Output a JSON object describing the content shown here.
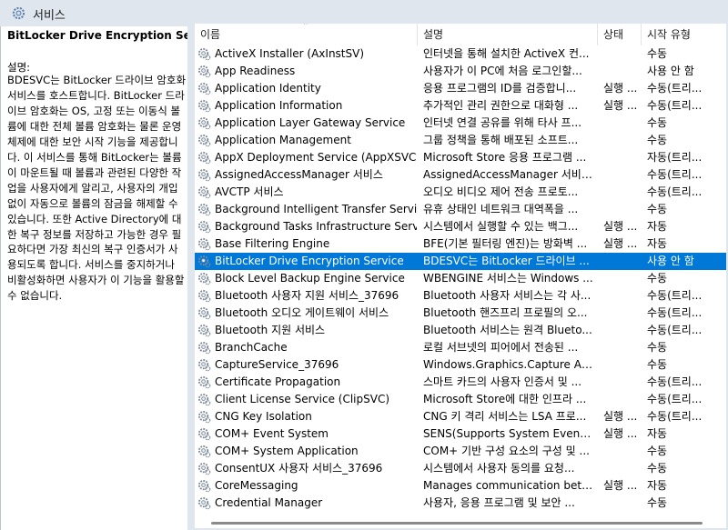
{
  "window": {
    "title": "서비스",
    "icon": "services-gear-icon"
  },
  "left_pane": {
    "service_title": "BitLocker Drive Encryption Service",
    "description_label": "설명:",
    "description_text": "BDESVC는 BitLocker 드라이브 암호화 서비스를 호스트합니다. BitLocker 드라이브 암호화는 OS, 고정 또는 이동식 볼륨에 대한 전체 볼륨 암호화는 물론 운영 체제에 대한 보안 시작 기능을 제공합니다. 이 서비스를 통해 BitLocker는 볼륨이 마운트될 때 볼륨과 관련된 다양한 작업을 사용자에게 알리고, 사용자의 개입 없이 자동으로 볼륨의 잠금을 해제할 수 있습니다. 또한 Active Directory에 대한 복구 정보를 저장하고 가능한 경우 필요하다면 가장 최신의 복구 인증서가 사용되도록 합니다. 서비스를 중지하거나 비활성화하면 사용자가 이 기능을 활용할 수 없습니다."
  },
  "columns": {
    "name": "이름",
    "description": "설명",
    "status": "상태",
    "startup": "시작 유형"
  },
  "selected_color": "#0078d7",
  "rows": [
    {
      "name": "ActiveX Installer (AxInstSV)",
      "desc": "인터넷을 통해 설치한 ActiveX 컨...",
      "status": "",
      "startup": "수동"
    },
    {
      "name": "App Readiness",
      "desc": "사용자가 이 PC에 처음 로그인할...",
      "status": "",
      "startup": "사용 안 함"
    },
    {
      "name": "Application Identity",
      "desc": "응용 프로그램의 ID를 검증합니...",
      "status": "실행 ...",
      "startup": "수동(트리..."
    },
    {
      "name": "Application Information",
      "desc": "추가적인 관리 권한으로 대화형 ...",
      "status": "실행 ...",
      "startup": "수동(트리..."
    },
    {
      "name": "Application Layer Gateway Service",
      "desc": "인터넷 연결 공유를 위해 타사 프...",
      "status": "",
      "startup": "수동"
    },
    {
      "name": "Application Management",
      "desc": "그룹 정책을 통해 배포된 소프트...",
      "status": "",
      "startup": "수동"
    },
    {
      "name": "AppX Deployment Service (AppXSVC)",
      "desc": "Microsoft Store 응용 프로그램 ...",
      "status": "",
      "startup": "자동(트리..."
    },
    {
      "name": "AssignedAccessManager 서비스",
      "desc": "AssignedAccessManager 서비스...",
      "status": "",
      "startup": "수동(트리..."
    },
    {
      "name": "AVCTP 서비스",
      "desc": "오디오 비디오 제어 전송 프로토...",
      "status": "",
      "startup": "수동(트리..."
    },
    {
      "name": "Background Intelligent Transfer Service",
      "desc": "유휴 상태인 네트워크 대역폭을 ...",
      "status": "",
      "startup": "수동"
    },
    {
      "name": "Background Tasks Infrastructure Service",
      "desc": "시스템에서 실행할 수 있는 백그...",
      "status": "실행 ...",
      "startup": "자동"
    },
    {
      "name": "Base Filtering Engine",
      "desc": "BFE(기본 필터링 엔진)는 방화벽 ...",
      "status": "실행 ...",
      "startup": "자동"
    },
    {
      "name": "BitLocker Drive Encryption Service",
      "desc": "BDESVC는 BitLocker 드라이브 ...",
      "status": "",
      "startup": "사용 안 함",
      "selected": true
    },
    {
      "name": "Block Level Backup Engine Service",
      "desc": "WBENGINE 서비스는 Windows ...",
      "status": "",
      "startup": "수동"
    },
    {
      "name": "Bluetooth 사용자 지원 서비스_37696",
      "desc": "Bluetooth 사용자 서비스는 각 사...",
      "status": "",
      "startup": "수동(트리..."
    },
    {
      "name": "Bluetooth 오디오 게이트웨이 서비스",
      "desc": "Bluetooth 핸즈프리 프로필의 오...",
      "status": "",
      "startup": "수동(트리..."
    },
    {
      "name": "Bluetooth 지원 서비스",
      "desc": "Bluetooth 서비스는 원격 Blueto...",
      "status": "",
      "startup": "수동(트리..."
    },
    {
      "name": "BranchCache",
      "desc": "로컬 서브넷의 피어에서 전송된 ...",
      "status": "",
      "startup": "수동"
    },
    {
      "name": "CaptureService_37696",
      "desc": "Windows.Graphics.Capture API...",
      "status": "",
      "startup": "수동"
    },
    {
      "name": "Certificate Propagation",
      "desc": "스마트 카드의 사용자 인증서 및 ...",
      "status": "",
      "startup": "수동(트리..."
    },
    {
      "name": "Client License Service (ClipSVC)",
      "desc": "Microsoft Store에 대한 인프라 ...",
      "status": "",
      "startup": "수동(트리..."
    },
    {
      "name": "CNG Key Isolation",
      "desc": "CNG 키 격리 서비스는 LSA 프로...",
      "status": "실행 ...",
      "startup": "수동(트리..."
    },
    {
      "name": "COM+ Event System",
      "desc": "SENS(Supports System Event N...",
      "status": "실행 ...",
      "startup": "자동"
    },
    {
      "name": "COM+ System Application",
      "desc": "COM+ 기반 구성 요소의 구성 및 ...",
      "status": "",
      "startup": "수동"
    },
    {
      "name": "ConsentUX 사용자 서비스_37696",
      "desc": "시스템에서 사용자 동의를 요청...",
      "status": "",
      "startup": "수동"
    },
    {
      "name": "CoreMessaging",
      "desc": "Manages communication betwe...",
      "status": "실행 ...",
      "startup": "자동"
    },
    {
      "name": "Credential Manager",
      "desc": "사용자, 응용 프로그램 및 보안 ...",
      "status": "",
      "startup": "수동"
    }
  ]
}
